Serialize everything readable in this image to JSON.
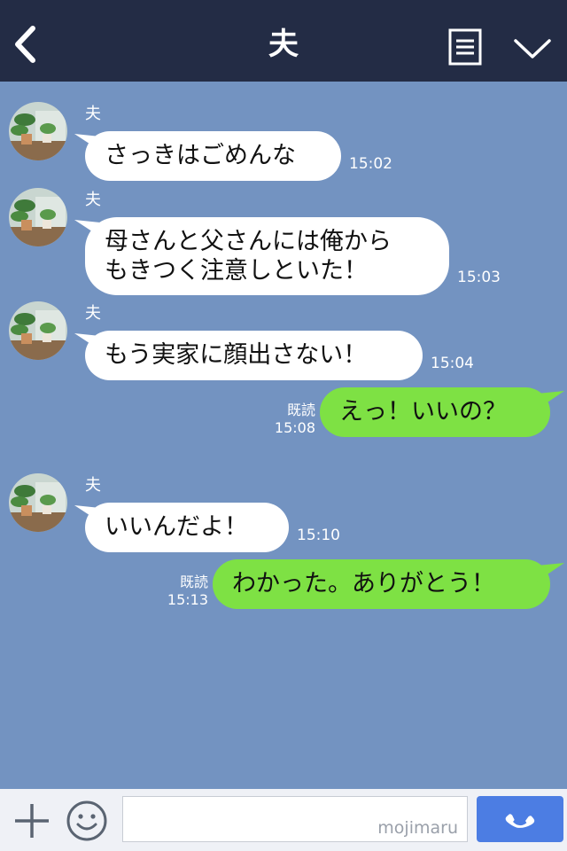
{
  "header": {
    "title": "夫",
    "icons": {
      "back": "chevron-left-icon",
      "memo": "memo-icon",
      "menu": "chevron-down-icon"
    }
  },
  "messages": [
    {
      "side": "in",
      "sender": "夫",
      "text": "さっきはごめんな",
      "time": "15:02"
    },
    {
      "side": "in",
      "sender": "夫",
      "text": "母さんと父さんには俺から\nもきつく注意しといた！",
      "time": "15:03"
    },
    {
      "side": "in",
      "sender": "夫",
      "text": "もう実家に顔出さない！",
      "time": "15:04"
    },
    {
      "side": "out",
      "read": "既読",
      "text": "えっ！いいの？",
      "time": "15:08"
    },
    {
      "side": "in",
      "sender": "夫",
      "text": "いいんだよ！",
      "time": "15:10"
    },
    {
      "side": "out",
      "read": "既読",
      "text": "わかった。ありがとう！",
      "time": "15:13"
    }
  ],
  "footer": {
    "input_value": "",
    "watermark": "mojimaru",
    "icons": {
      "plus": "plus-icon",
      "emoji": "smiley-icon",
      "call": "phone-icon"
    }
  },
  "colors": {
    "background": "#7393c1",
    "header": "#232c45",
    "incoming_bubble": "#ffffff",
    "outgoing_bubble": "#7ee144",
    "call_button": "#4c7de3"
  }
}
